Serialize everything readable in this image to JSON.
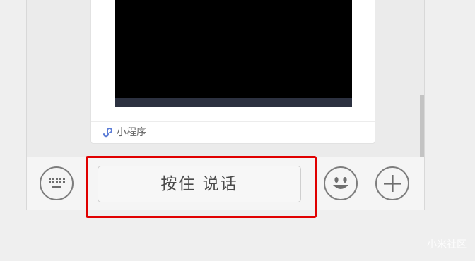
{
  "mini_program": {
    "label": "小程序",
    "icon": "mini-program-icon"
  },
  "input_bar": {
    "keyboard_icon": "keyboard-icon",
    "talk_label": "按住 说话",
    "emoji_icon": "emoji-icon",
    "plus_icon": "plus-icon"
  },
  "watermark": "小米社区",
  "colors": {
    "highlight": "#e00000",
    "video_bg": "#000000",
    "video_bar": "#2c3140"
  }
}
